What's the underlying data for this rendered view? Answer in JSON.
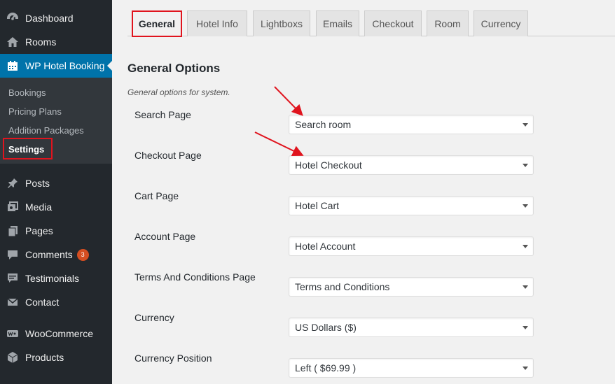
{
  "sidebar": {
    "items": [
      {
        "label": "Dashboard",
        "icon": "dashboard-icon"
      },
      {
        "label": "Rooms",
        "icon": "home-icon"
      },
      {
        "label": "WP Hotel Booking",
        "icon": "calendar-icon"
      },
      {
        "label": "Posts",
        "icon": "pin-icon"
      },
      {
        "label": "Media",
        "icon": "media-icon"
      },
      {
        "label": "Pages",
        "icon": "pages-icon"
      },
      {
        "label": "Comments",
        "icon": "comment-icon",
        "badge": "3"
      },
      {
        "label": "Testimonials",
        "icon": "testimonial-icon"
      },
      {
        "label": "Contact",
        "icon": "mail-icon"
      },
      {
        "label": "WooCommerce",
        "icon": "woo-icon"
      },
      {
        "label": "Products",
        "icon": "products-icon"
      }
    ],
    "submenu": [
      "Bookings",
      "Pricing Plans",
      "Addition Packages",
      "Settings"
    ]
  },
  "tabs": [
    "General",
    "Hotel Info",
    "Lightboxs",
    "Emails",
    "Checkout",
    "Room",
    "Currency"
  ],
  "section": {
    "heading": "General Options",
    "description": "General options for system."
  },
  "fields": [
    {
      "label": "Search Page",
      "value": "Search room"
    },
    {
      "label": "Checkout Page",
      "value": "Hotel Checkout"
    },
    {
      "label": "Cart Page",
      "value": "Hotel Cart"
    },
    {
      "label": "Account Page",
      "value": "Hotel Account"
    },
    {
      "label": "Terms And Conditions Page",
      "value": "Terms and Conditions"
    },
    {
      "label": "Currency",
      "value": "US Dollars ($)"
    },
    {
      "label": "Currency Position",
      "value": "Left ( $69.99 )"
    }
  ],
  "colors": {
    "sidebar_bg": "#23282d",
    "active_bg": "#0073aa",
    "highlight": "#e0141e",
    "badge": "#d54e21"
  }
}
